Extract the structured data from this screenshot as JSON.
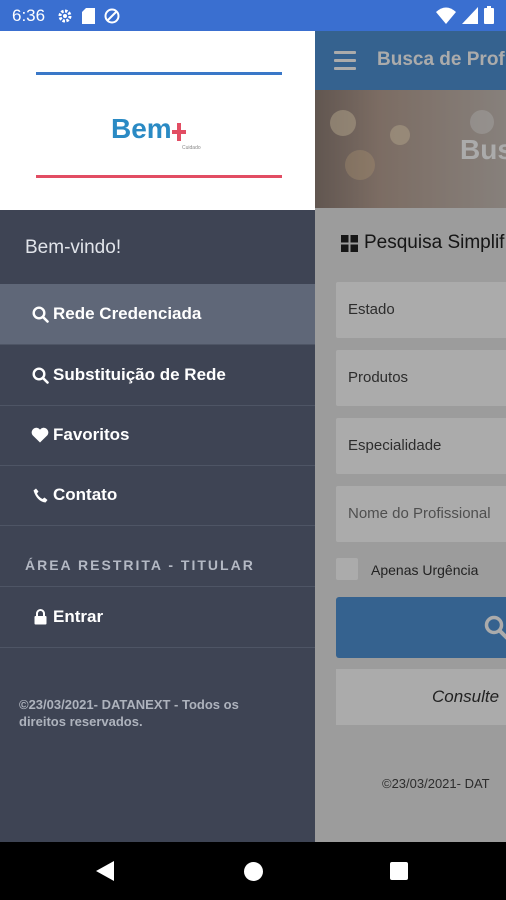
{
  "status_bar": {
    "time": "6:36"
  },
  "app": {
    "title": "Busca de Profi",
    "hero_text": "Bus",
    "search_section": "Pesquisa Simplif",
    "fields": [
      "Estado",
      "Produtos",
      "Especialidade",
      "Nome do Profissional"
    ],
    "checkbox_label": "Apenas Urgência",
    "consult_text": "Consulte",
    "footer": "©23/03/2021- DAT"
  },
  "drawer": {
    "logo_text": "Bem",
    "logo_sub": "Cuidado",
    "welcome": "Bem-vindo!",
    "items": [
      {
        "label": "Rede Credenciada",
        "icon": "search-icon"
      },
      {
        "label": "Substituição de Rede",
        "icon": "search-icon"
      },
      {
        "label": "Favoritos",
        "icon": "heart-icon"
      },
      {
        "label": "Contato",
        "icon": "phone-icon"
      }
    ],
    "section_label": "ÁREA RESTRITA - TITULAR",
    "login_label": "Entrar",
    "copyright": "©23/03/2021- DATANEXT - Todos os direitos reservados."
  },
  "colors": {
    "status_bar": "#3a6fd0",
    "app_bar": "#4f92d6",
    "drawer_bg": "#3e4454",
    "drawer_active": "#5f6778",
    "logo_blue": "#2a8ac4",
    "logo_red": "#e24d63"
  }
}
